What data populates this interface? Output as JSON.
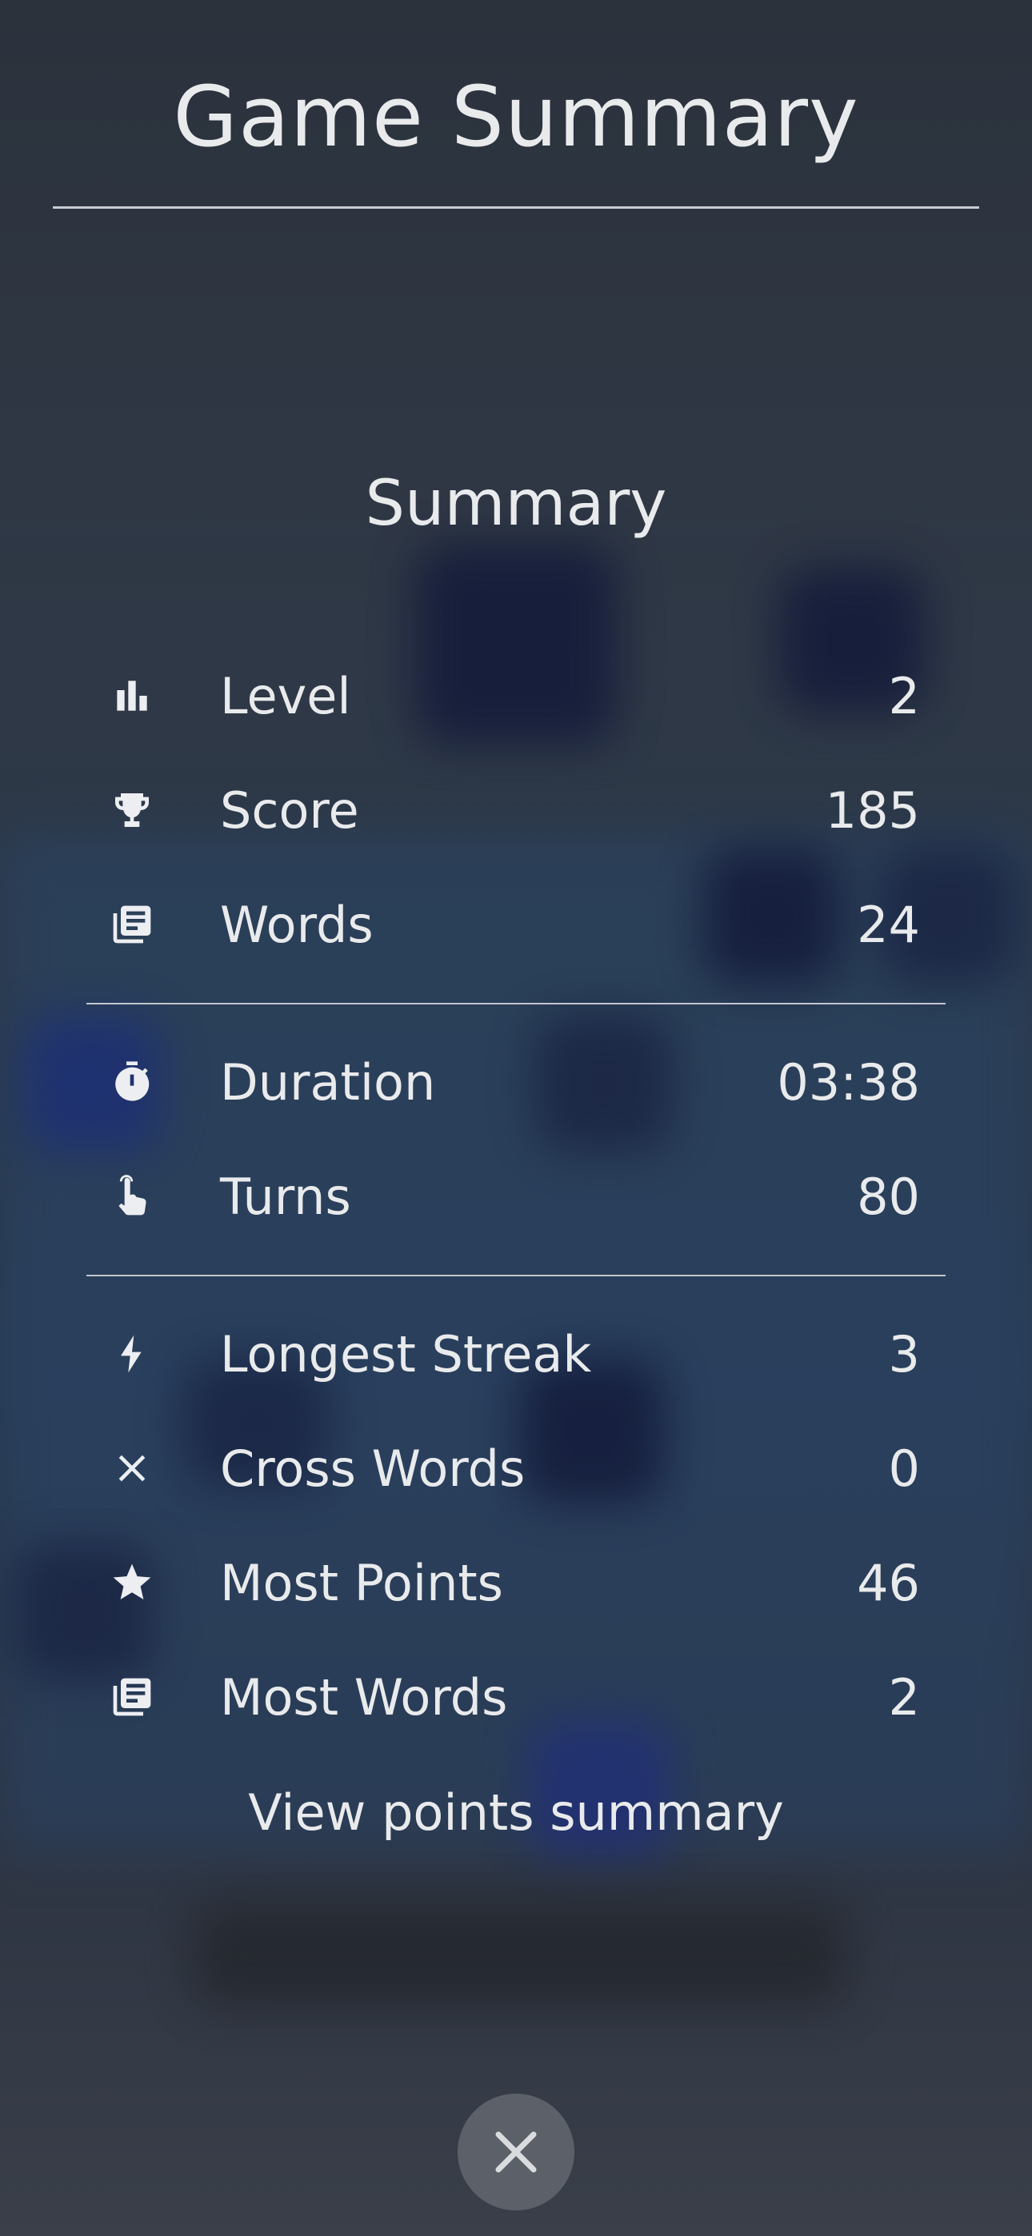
{
  "header": {
    "title": "Game Summary"
  },
  "summary": {
    "heading": "Summary",
    "groups": [
      {
        "rows": [
          {
            "icon": "bar-chart-icon",
            "label": "Level",
            "value": "2"
          },
          {
            "icon": "trophy-icon",
            "label": "Score",
            "value": "185"
          },
          {
            "icon": "library-books-icon",
            "label": "Words",
            "value": "24"
          }
        ]
      },
      {
        "rows": [
          {
            "icon": "stopwatch-icon",
            "label": "Duration",
            "value": "03:38"
          },
          {
            "icon": "tap-hand-icon",
            "label": "Turns",
            "value": "80"
          }
        ]
      },
      {
        "rows": [
          {
            "icon": "lightning-bolt-icon",
            "label": "Longest Streak",
            "value": "3"
          },
          {
            "icon": "cross-icon",
            "label": "Cross Words",
            "value": "0"
          },
          {
            "icon": "star-icon",
            "label": "Most Points",
            "value": "46"
          },
          {
            "icon": "library-books-icon",
            "label": "Most Words",
            "value": "2"
          }
        ]
      }
    ],
    "link_label": "View points summary"
  },
  "close_button": {
    "icon": "close-icon"
  }
}
